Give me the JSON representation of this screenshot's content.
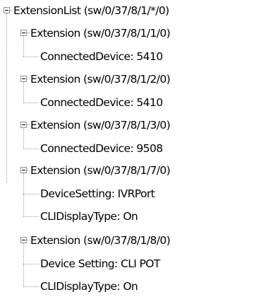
{
  "tree": {
    "root": {
      "label": "ExtensionList (sw/0/37/8/1/*/0)",
      "expanded": true,
      "children": [
        {
          "label": "Extension (sw/0/37/8/1/1/0)",
          "expanded": true,
          "children": [
            {
              "label": "ConnectedDevice: 5410"
            }
          ]
        },
        {
          "label": "Extension (sw/0/37/8/1/2/0)",
          "expanded": true,
          "children": [
            {
              "label": "ConnectedDevice: 5410"
            }
          ]
        },
        {
          "label": "Extension (sw/0/37/8/1/3/0)",
          "expanded": true,
          "children": [
            {
              "label": "ConnectedDevice: 9508"
            }
          ]
        },
        {
          "label": "Extension (sw/0/37/8/1/7/0)",
          "expanded": true,
          "children": [
            {
              "label": "DeviceSetting: IVRPort"
            },
            {
              "label": "CLIDisplayType: On"
            }
          ]
        },
        {
          "label": "Extension (sw/0/37/8/1/8/0)",
          "expanded": true,
          "children": [
            {
              "label": "Device Setting: CLI POT"
            },
            {
              "label": "CLIDisplayType: On"
            }
          ]
        }
      ]
    }
  }
}
